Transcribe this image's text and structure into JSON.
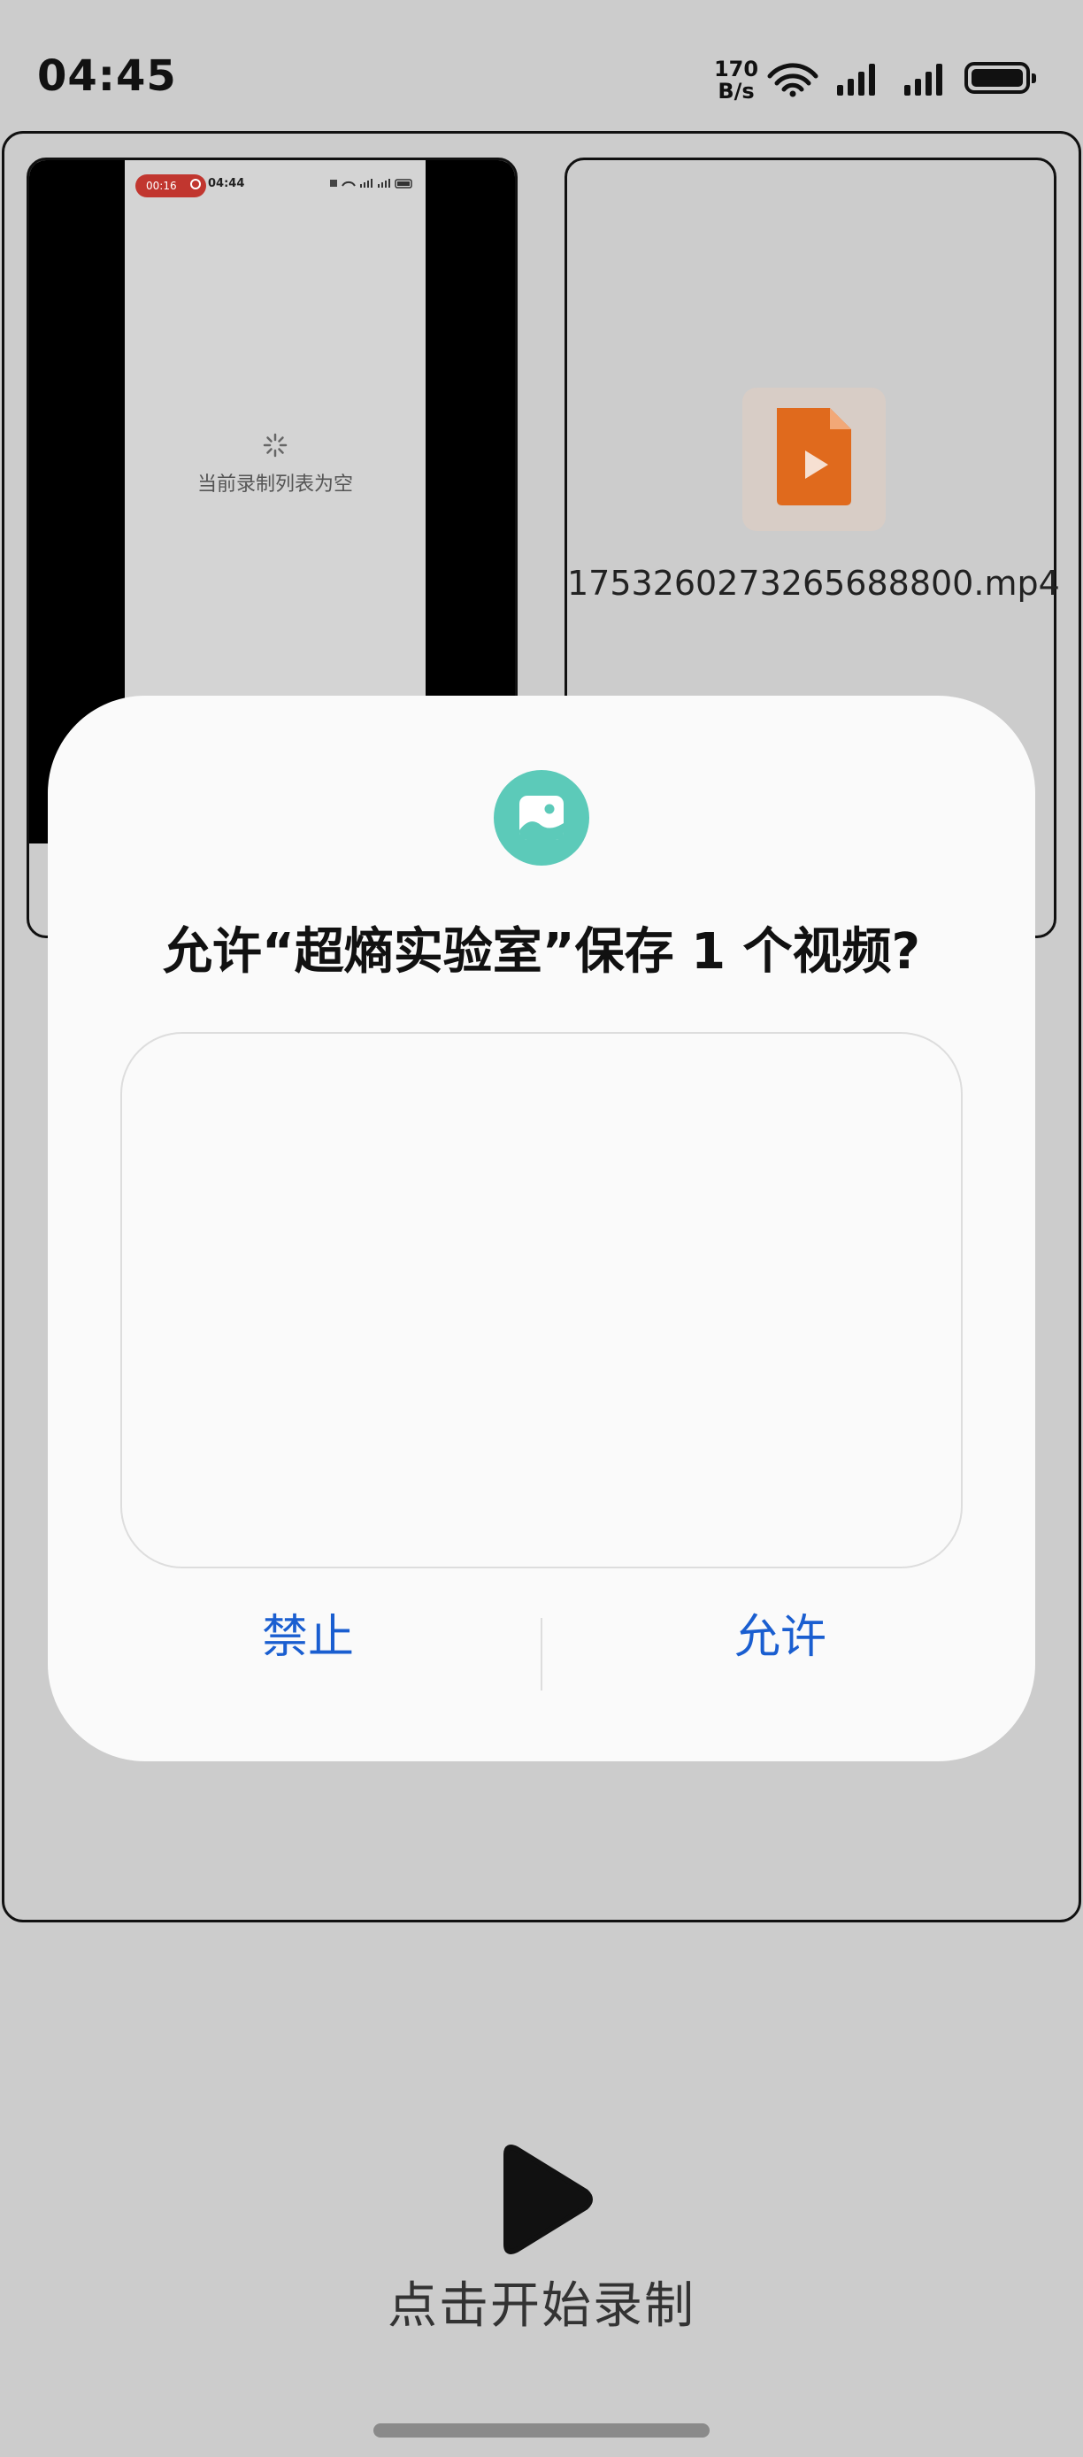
{
  "status_bar": {
    "time": "04:45",
    "net_speed_value": "170",
    "net_speed_unit": "B/s",
    "battery_level": "high"
  },
  "recordings": {
    "preview": {
      "timer": "00:16",
      "time": "04:44",
      "empty_text": "当前录制列表为空"
    },
    "file": {
      "name": "1753260273265688800.mp4",
      "icon": "video-file-icon",
      "icon_color": "#e06a1d"
    }
  },
  "dialog": {
    "icon": "image-icon",
    "icon_color": "#5ccab9",
    "title": "允许“超熵实验室”保存 1 个视频?",
    "deny_label": "禁止",
    "allow_label": "允许",
    "button_color": "#1a5ed0"
  },
  "footer": {
    "start_label": "点击开始录制"
  }
}
